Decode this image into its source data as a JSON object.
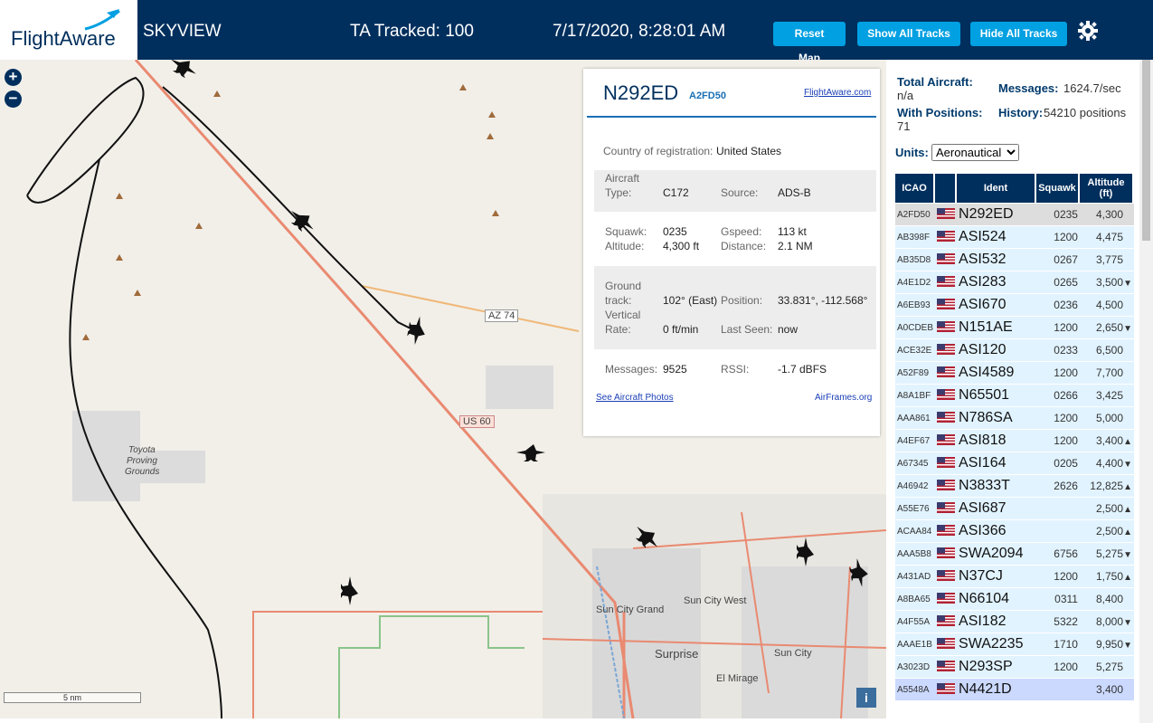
{
  "header": {
    "logo": "FlightAware",
    "app_name": "SKYVIEW",
    "tracked": "TA Tracked: 100",
    "datetime": "7/17/2020, 8:28:01 AM",
    "btn_reset": "Reset Map",
    "btn_show": "Show All Tracks",
    "btn_hide": "Hide All Tracks",
    "colors": {
      "bar": "#002f5d",
      "button": "#00a0e2"
    }
  },
  "map": {
    "zoom_in": "+",
    "zoom_out": "−",
    "scale": "5 nm",
    "info": "i",
    "labels": {
      "az74": "AZ 74",
      "us60": "US 60",
      "toyota1": "Toyota",
      "toyota2": "Proving",
      "toyota3": "Grounds",
      "suncitywest": "Sun City West",
      "suncitygrand": "Sun City Grand",
      "surprise": "Surprise",
      "suncity": "Sun City",
      "elmirage": "El Mirage"
    }
  },
  "popup": {
    "ident": "N292ED",
    "icao": "A2FD50",
    "link": "FlightAware.com",
    "country_label": "Country of registration:",
    "country": "United States",
    "type_label1": "Aircraft",
    "type_label2": "Type:",
    "type": "C172",
    "source_label": "Source:",
    "source": "ADS-B",
    "squawk_label": "Squawk:",
    "squawk": "0235",
    "gspeed_label": "Gspeed:",
    "gspeed": "113 kt",
    "altitude_label": "Altitude:",
    "altitude": "4,300 ft",
    "distance_label": "Distance:",
    "distance": "2.1 NM",
    "track_label1": "Ground",
    "track_label2": "track:",
    "track": "102° (East)",
    "position_label": "Position:",
    "position": "33.831°, -112.568°",
    "vrate_label1": "Vertical",
    "vrate_label2": "Rate:",
    "vrate": "0 ft/min",
    "lastseen_label": "Last Seen:",
    "lastseen": "now",
    "messages_label": "Messages:",
    "messages": "9525",
    "rssi_label": "RSSI:",
    "rssi": "-1.7 dBFS",
    "photos_link": "See Aircraft Photos",
    "airframes_link": "AirFrames.org"
  },
  "sidebar": {
    "total_label": "Total Aircraft:",
    "total": "n/a",
    "messages_label": "Messages:",
    "messages": "1624.7/sec",
    "positions_label": "With Positions:",
    "positions": "71",
    "history_label": "History:",
    "history": "54210 positions",
    "units_label": "Units:",
    "units_value": "Aeronautical",
    "columns": [
      "ICAO",
      "",
      "Ident",
      "Squawk",
      "Altitude (ft)"
    ],
    "rows": [
      {
        "icao": "A2FD50",
        "ident": "N292ED",
        "squawk": "0235",
        "alt": "4,300",
        "trend": ""
      },
      {
        "icao": "AB398F",
        "ident": "ASI524",
        "squawk": "1200",
        "alt": "4,475",
        "trend": ""
      },
      {
        "icao": "AB35D8",
        "ident": "ASI532",
        "squawk": "0267",
        "alt": "3,775",
        "trend": ""
      },
      {
        "icao": "A4E1D2",
        "ident": "ASI283",
        "squawk": "0265",
        "alt": "3,500",
        "trend": "▼"
      },
      {
        "icao": "A6EB93",
        "ident": "ASI670",
        "squawk": "0236",
        "alt": "4,500",
        "trend": ""
      },
      {
        "icao": "A0CDEB",
        "ident": "N151AE",
        "squawk": "1200",
        "alt": "2,650",
        "trend": "▼"
      },
      {
        "icao": "ACE32E",
        "ident": "ASI120",
        "squawk": "0233",
        "alt": "6,500",
        "trend": ""
      },
      {
        "icao": "A52F89",
        "ident": "ASI4589",
        "squawk": "1200",
        "alt": "7,700",
        "trend": ""
      },
      {
        "icao": "A8A1BF",
        "ident": "N65501",
        "squawk": "0266",
        "alt": "3,425",
        "trend": ""
      },
      {
        "icao": "AAA861",
        "ident": "N786SA",
        "squawk": "1200",
        "alt": "5,000",
        "trend": ""
      },
      {
        "icao": "A4EF67",
        "ident": "ASI818",
        "squawk": "1200",
        "alt": "3,400",
        "trend": "▲"
      },
      {
        "icao": "A67345",
        "ident": "ASI164",
        "squawk": "0205",
        "alt": "4,400",
        "trend": "▼"
      },
      {
        "icao": "A46942",
        "ident": "N3833T",
        "squawk": "2626",
        "alt": "12,825",
        "trend": "▲"
      },
      {
        "icao": "A55E76",
        "ident": "ASI687",
        "squawk": "",
        "alt": "2,500",
        "trend": "▲"
      },
      {
        "icao": "ACAA84",
        "ident": "ASI366",
        "squawk": "",
        "alt": "2,500",
        "trend": "▲"
      },
      {
        "icao": "AAA5B8",
        "ident": "SWA2094",
        "squawk": "6756",
        "alt": "5,275",
        "trend": "▼"
      },
      {
        "icao": "A431AD",
        "ident": "N37CJ",
        "squawk": "1200",
        "alt": "1,750",
        "trend": "▲"
      },
      {
        "icao": "A8BA65",
        "ident": "N66104",
        "squawk": "0311",
        "alt": "8,400",
        "trend": ""
      },
      {
        "icao": "A4F55A",
        "ident": "ASI182",
        "squawk": "5322",
        "alt": "8,000",
        "trend": "▼"
      },
      {
        "icao": "AAAE1B",
        "ident": "SWA2235",
        "squawk": "1710",
        "alt": "9,950",
        "trend": "▼"
      },
      {
        "icao": "A3023D",
        "ident": "N293SP",
        "squawk": "1200",
        "alt": "5,275",
        "trend": ""
      },
      {
        "icao": "A5548A",
        "ident": "N4421D",
        "squawk": "",
        "alt": "3,400",
        "trend": ""
      }
    ]
  }
}
